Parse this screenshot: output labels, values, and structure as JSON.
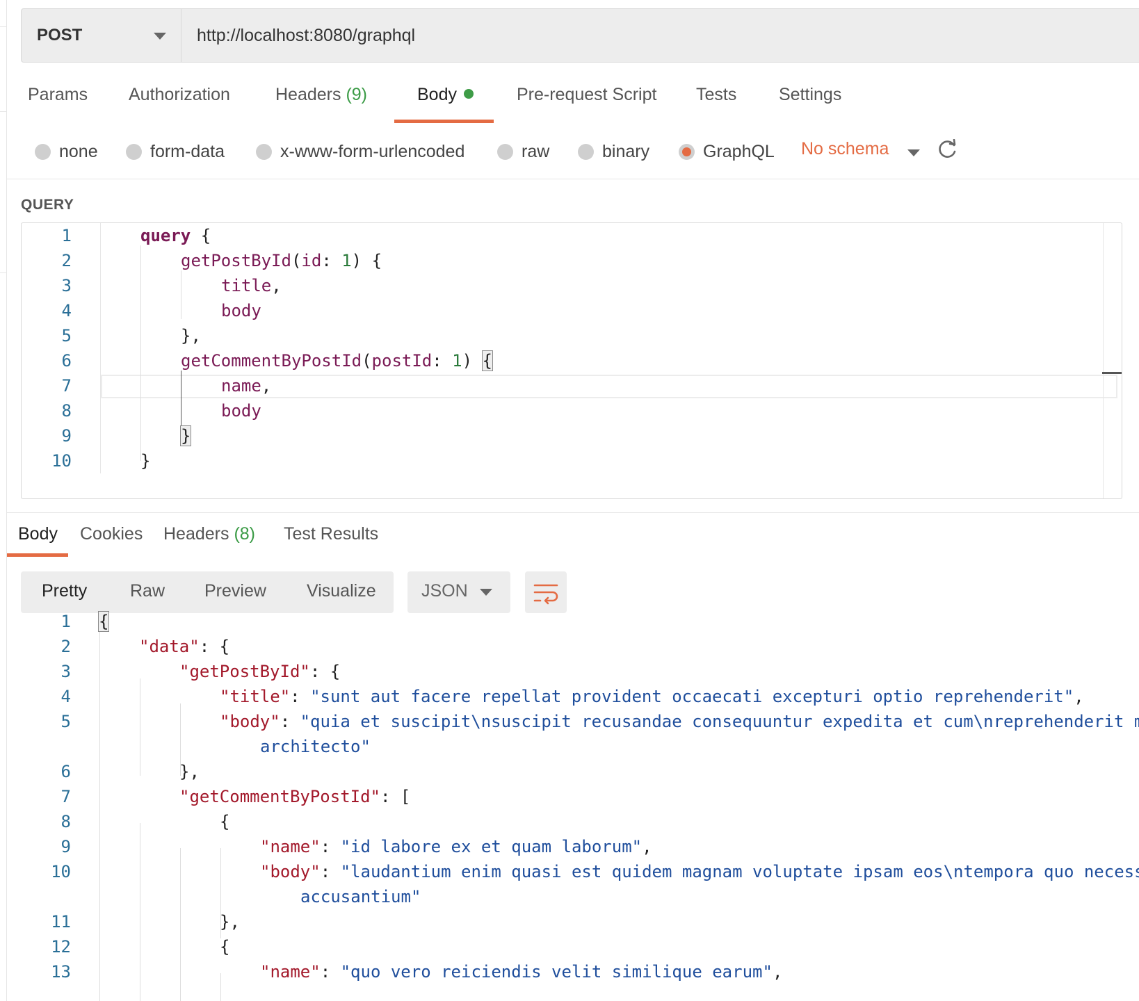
{
  "request": {
    "method": "POST",
    "url": "http://localhost:8080/graphql"
  },
  "request_tabs": {
    "params": "Params",
    "authorization": "Authorization",
    "headers": "Headers",
    "headers_count": "(9)",
    "body": "Body",
    "pre_request": "Pre-request Script",
    "tests": "Tests",
    "settings": "Settings",
    "active": "Body"
  },
  "body_types": {
    "none": "none",
    "form_data": "form-data",
    "urlencoded": "x-www-form-urlencoded",
    "raw": "raw",
    "binary": "binary",
    "graphql": "GraphQL",
    "selected": "GraphQL",
    "schema": "No schema"
  },
  "query_section": {
    "label": "QUERY",
    "line_numbers": [
      "1",
      "2",
      "3",
      "4",
      "5",
      "6",
      "7",
      "8",
      "9",
      "10"
    ],
    "lines": [
      {
        "kw": "query",
        "rest": " {"
      },
      {
        "fn": "getPostById",
        "open": "(",
        "arg": "id",
        "colon": ": ",
        "num": "1",
        "close": ") {"
      },
      {
        "field": "title",
        "rest": ","
      },
      {
        "field": "body",
        "rest": ""
      },
      {
        "text": "},"
      },
      {
        "fn": "getCommentByPostId",
        "open": "(",
        "arg": "postId",
        "colon": ": ",
        "num": "1",
        "close": ") ",
        "brace": "{"
      },
      {
        "field": "name",
        "rest": ","
      },
      {
        "field": "body",
        "rest": ""
      },
      {
        "text": "}"
      },
      {
        "text": "}"
      }
    ]
  },
  "response_tabs": {
    "body": "Body",
    "cookies": "Cookies",
    "headers": "Headers",
    "headers_count": "(8)",
    "test_results": "Test Results",
    "active": "Body"
  },
  "view_modes": {
    "pretty": "Pretty",
    "raw": "Raw",
    "preview": "Preview",
    "visualize": "Visualize",
    "active": "Pretty",
    "format": "JSON"
  },
  "response": {
    "line_numbers": [
      "1",
      "2",
      "3",
      "4",
      "5",
      "6",
      "7",
      "8",
      "9",
      "10",
      "11",
      "12",
      "13"
    ],
    "l1": "{",
    "l2_key": "\"data\"",
    "l2_rest": ": {",
    "l3_key": "\"getPostById\"",
    "l3_rest": ": {",
    "l4_key": "\"title\"",
    "l4_sep": ": ",
    "l4_val": "\"sunt aut facere repellat provident occaecati excepturi optio reprehenderit\"",
    "l4_end": ",",
    "l5_key": "\"body\"",
    "l5_sep": ": ",
    "l5_val": "\"quia et suscipit\\nsuscipit recusandae consequuntur expedita et cum\\nreprehenderit m",
    "l5_wrap": "architecto\"",
    "l6": "},",
    "l7_key": "\"getCommentByPostId\"",
    "l7_rest": ": [",
    "l8": "{",
    "l9_key": "\"name\"",
    "l9_sep": ": ",
    "l9_val": "\"id labore ex et quam laborum\"",
    "l9_end": ",",
    "l10_key": "\"body\"",
    "l10_sep": ": ",
    "l10_val": "\"laudantium enim quasi est quidem magnam voluptate ipsam eos\\ntempora quo necess",
    "l10_wrap": "accusantium\"",
    "l11": "},",
    "l12": "{",
    "l13_key": "\"name\"",
    "l13_sep": ": ",
    "l13_val": "\"quo vero reiciendis velit similique earum\"",
    "l13_end": ","
  },
  "colors": {
    "accent": "#e46b43",
    "success": "#3e9c47",
    "keyword": "#7a1a55",
    "json_key": "#a3192b",
    "json_string": "#1f4e9c",
    "line_number": "#2a6f97"
  },
  "icons": {
    "method_dropdown": "chevron-down-icon",
    "schema_dropdown": "chevron-down-icon",
    "refresh": "refresh-icon",
    "format_dropdown": "chevron-down-icon",
    "wrap_lines": "wrap-lines-icon"
  }
}
